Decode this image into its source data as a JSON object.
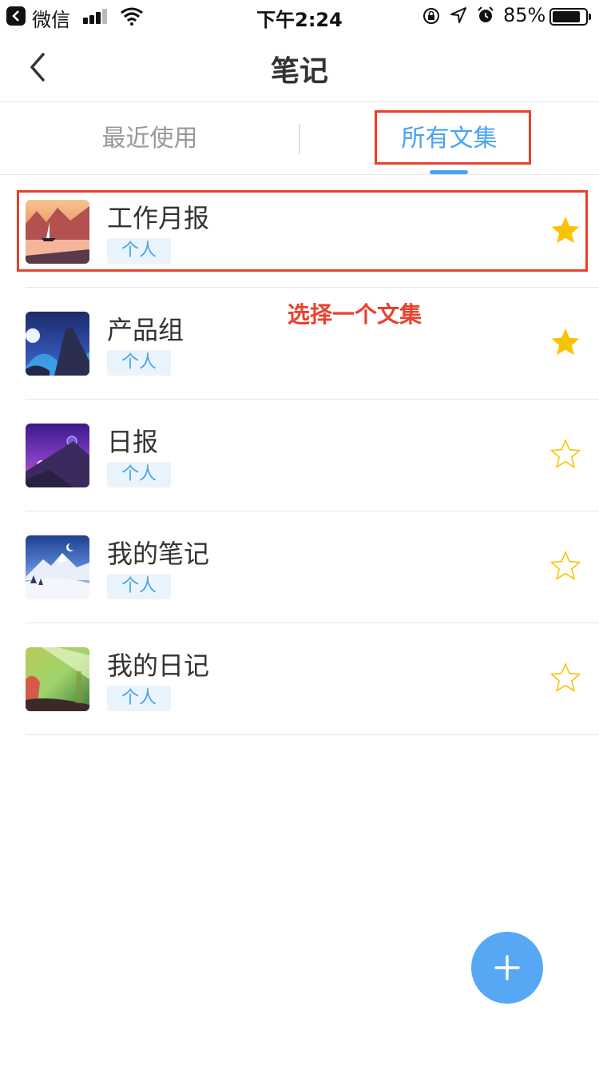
{
  "status_bar": {
    "carrier": "微信",
    "time": "下午2:24",
    "battery_percent": "85%",
    "battery_level": 0.85,
    "icons": [
      "back-app-icon",
      "signal-icon",
      "wifi-icon",
      "orientation-lock-icon",
      "location-icon",
      "alarm-icon",
      "battery-icon"
    ]
  },
  "nav": {
    "title": "笔记",
    "back_icon": "chevron-left-icon"
  },
  "tabs": [
    {
      "label": "最近使用",
      "active": false
    },
    {
      "label": "所有文集",
      "active": true
    }
  ],
  "notebooks": [
    {
      "title": "工作月报",
      "tag": "个人",
      "starred": true,
      "thumbnail": "sunset-sailboat"
    },
    {
      "title": "产品组",
      "tag": "个人",
      "starred": true,
      "thumbnail": "night-aurora"
    },
    {
      "title": "日报",
      "tag": "个人",
      "starred": false,
      "thumbnail": "purple-planet"
    },
    {
      "title": "我的笔记",
      "tag": "个人",
      "starred": false,
      "thumbnail": "snow-mountain"
    },
    {
      "title": "我的日记",
      "tag": "个人",
      "starred": false,
      "thumbnail": "green-forest"
    }
  ],
  "annotation": "选择一个文集",
  "fab": {
    "icon": "plus-icon"
  },
  "colors": {
    "accent": "#4aa3f0",
    "star": "#f8c300",
    "highlight": "#e8412c",
    "tag_bg": "#eaf4fd",
    "fab": "#56a8f5"
  }
}
